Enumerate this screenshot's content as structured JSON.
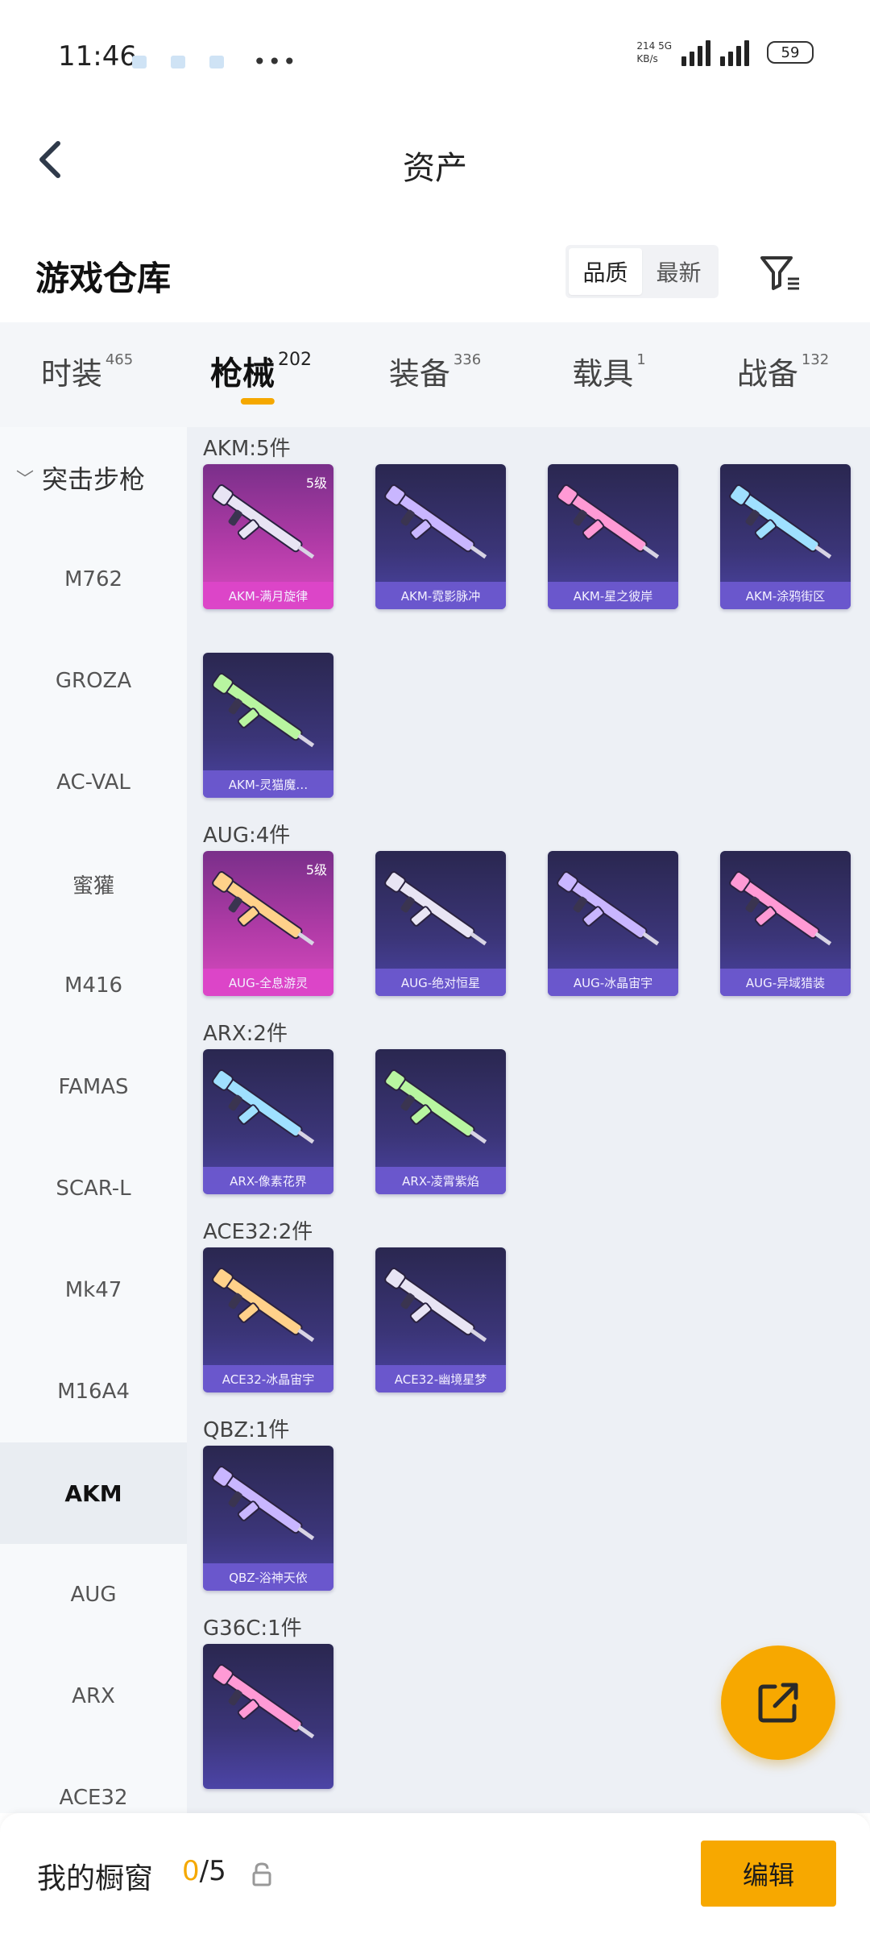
{
  "status_bar": {
    "time": "11:46",
    "net_speed_top": "214 5G",
    "net_speed_bottom": "KB/s",
    "battery": "59"
  },
  "header": {
    "title": "资产"
  },
  "section": {
    "title": "游戏仓库",
    "sort_options": [
      "品质",
      "最新"
    ]
  },
  "tabs": [
    {
      "label": "时装",
      "count": "465"
    },
    {
      "label": "枪械",
      "count": "202",
      "active": true
    },
    {
      "label": "装备",
      "count": "336"
    },
    {
      "label": "载具",
      "count": "1"
    },
    {
      "label": "战备",
      "count": "132"
    }
  ],
  "sidebar": {
    "group": "突击步枪",
    "items": [
      "M762",
      "GROZA",
      "AC-VAL",
      "蜜獾",
      "M416",
      "FAMAS",
      "SCAR-L",
      "Mk47",
      "M16A4",
      "AKM",
      "AUG",
      "ARX",
      "ACE32"
    ],
    "active_item": "AKM"
  },
  "groups": [
    {
      "label": "AKM:5件",
      "items": [
        {
          "name": "AKM-满月旋律",
          "level": "5级",
          "rarity": "pink"
        },
        {
          "name": "AKM-霓影脉冲",
          "rarity": "purple"
        },
        {
          "name": "AKM-星之彼岸",
          "rarity": "purple"
        },
        {
          "name": "AKM-涂鸦街区",
          "rarity": "purple"
        },
        {
          "name": "AKM-灵猫魔…",
          "rarity": "purple"
        }
      ]
    },
    {
      "label": "AUG:4件",
      "items": [
        {
          "name": "AUG-全息游灵",
          "level": "5级",
          "rarity": "pink"
        },
        {
          "name": "AUG-绝对恒星",
          "rarity": "purple"
        },
        {
          "name": "AUG-冰晶宙宇",
          "rarity": "purple"
        },
        {
          "name": "AUG-异域猎装",
          "rarity": "purple"
        }
      ]
    },
    {
      "label": "ARX:2件",
      "items": [
        {
          "name": "ARX-像素花界",
          "rarity": "purple"
        },
        {
          "name": "ARX-凌霄紫焰",
          "rarity": "purple"
        }
      ]
    },
    {
      "label": "ACE32:2件",
      "items": [
        {
          "name": "ACE32-冰晶宙宇",
          "rarity": "purple"
        },
        {
          "name": "ACE32-幽境星梦",
          "rarity": "purple"
        }
      ]
    },
    {
      "label": "QBZ:1件",
      "items": [
        {
          "name": "QBZ-浴神天依",
          "rarity": "purple"
        }
      ]
    },
    {
      "label": "G36C:1件",
      "items": [
        {
          "name": "",
          "rarity": "purple"
        }
      ]
    }
  ],
  "bottom_bar": {
    "label": "我的橱窗",
    "current": "0",
    "total": "/5",
    "edit_label": "编辑"
  },
  "colors": {
    "accent": "#f7a800",
    "card_purple": "#3b3578",
    "card_pink": "#b13ba7"
  },
  "icons": [
    "back-arrow-icon",
    "filter-icon",
    "lock-icon",
    "share-icon"
  ]
}
